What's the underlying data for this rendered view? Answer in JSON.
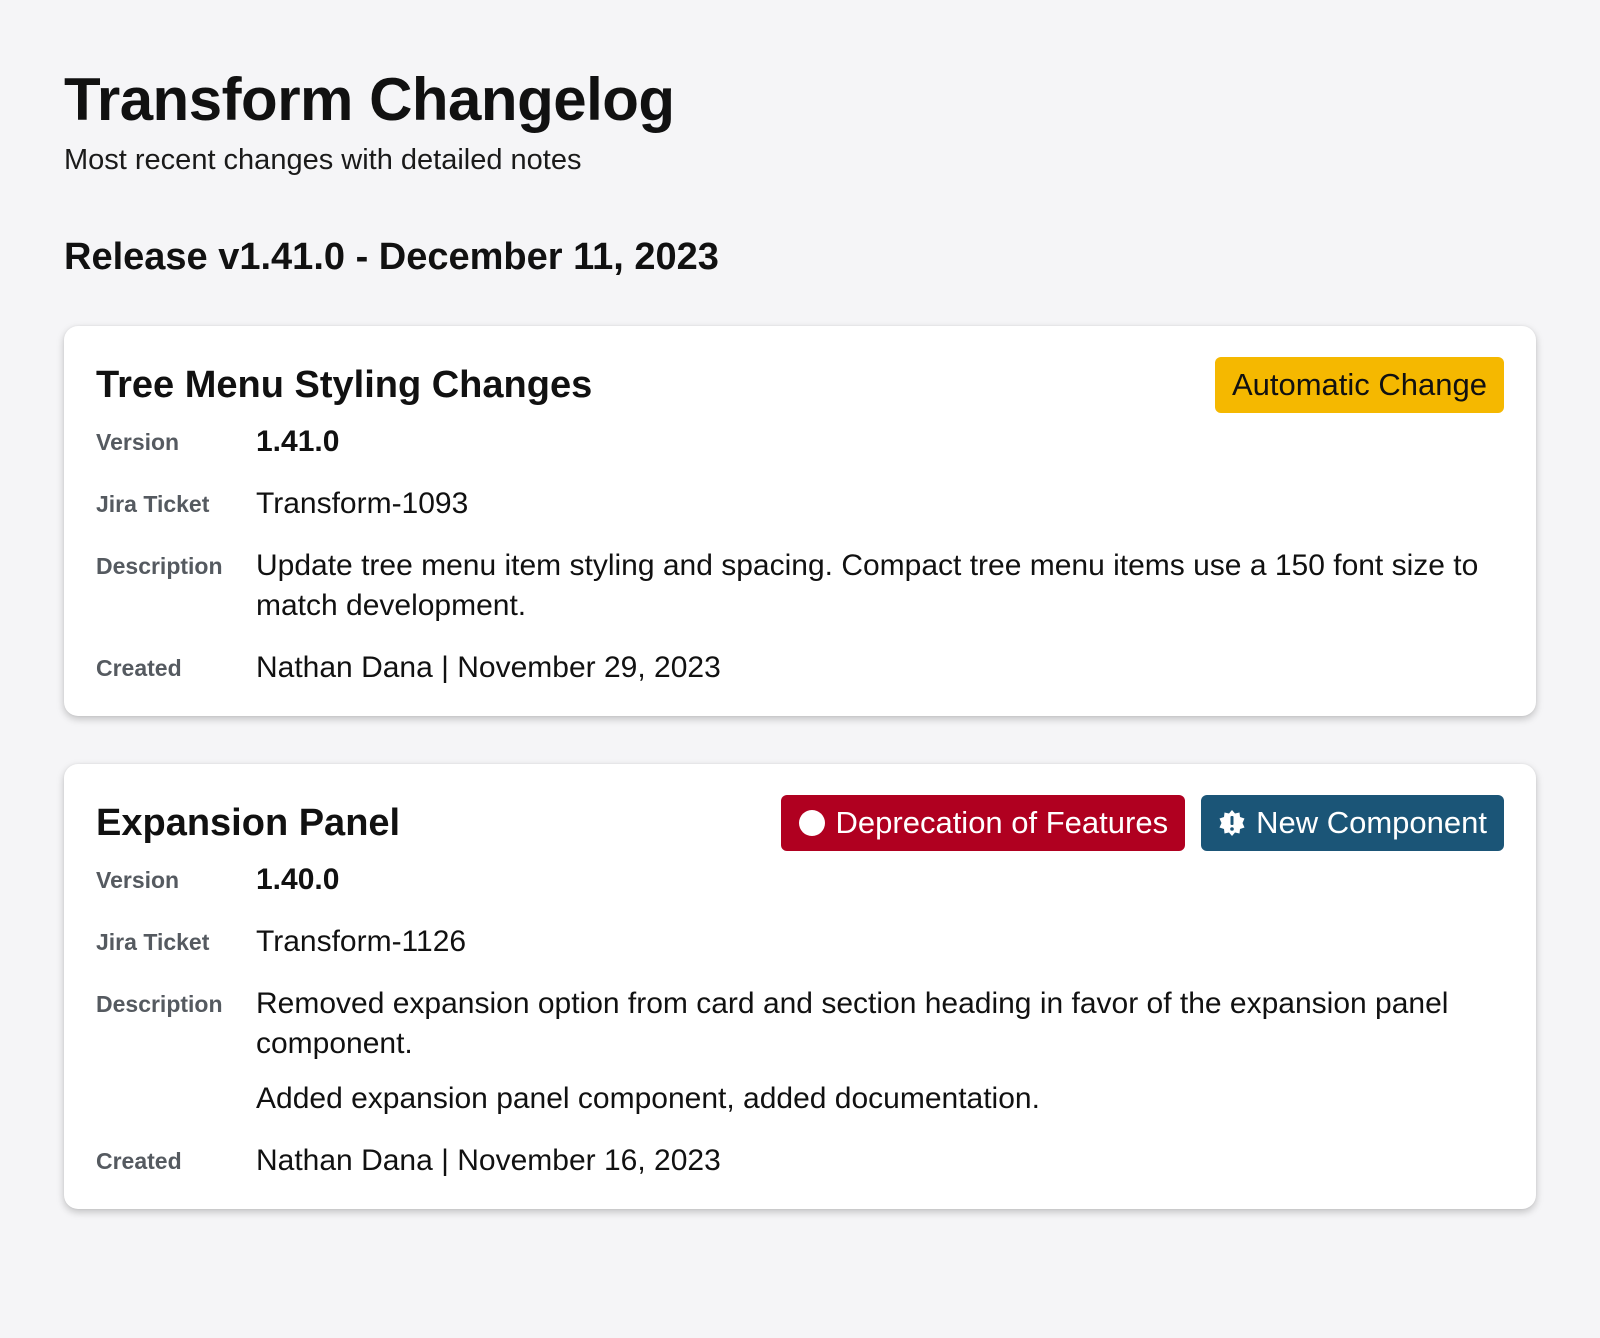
{
  "header": {
    "title": "Transform Changelog",
    "subtitle": "Most recent changes with detailed notes"
  },
  "release": {
    "heading": "Release v1.41.0 - December 11, 2023"
  },
  "labels": {
    "version": "Version",
    "jira": "Jira Ticket",
    "description": "Description",
    "created": "Created"
  },
  "colors": {
    "automatic_change": "#f5b800",
    "deprecation": "#b00020",
    "new_component": "#1b5577"
  },
  "entries": [
    {
      "title": "Tree Menu Styling Changes",
      "badges": [
        {
          "label": "Automatic Change",
          "icon": "none"
        }
      ],
      "version": "1.41.0",
      "jira": "Transform-1093",
      "description": [
        "Update tree menu item styling and spacing. Compact tree menu items use a 150 font size to match development."
      ],
      "created": "Nathan Dana | November 29, 2023"
    },
    {
      "title": "Expansion Panel",
      "badges": [
        {
          "label": "Deprecation of Features",
          "icon": "circle-icon"
        },
        {
          "label": "New Component",
          "icon": "new-badge-icon"
        }
      ],
      "version": "1.40.0",
      "jira": "Transform-1126",
      "description": [
        "Removed expansion option from card and section heading in favor of the expansion panel component.",
        "Added expansion panel component, added documentation."
      ],
      "created": "Nathan Dana | November 16, 2023"
    }
  ]
}
